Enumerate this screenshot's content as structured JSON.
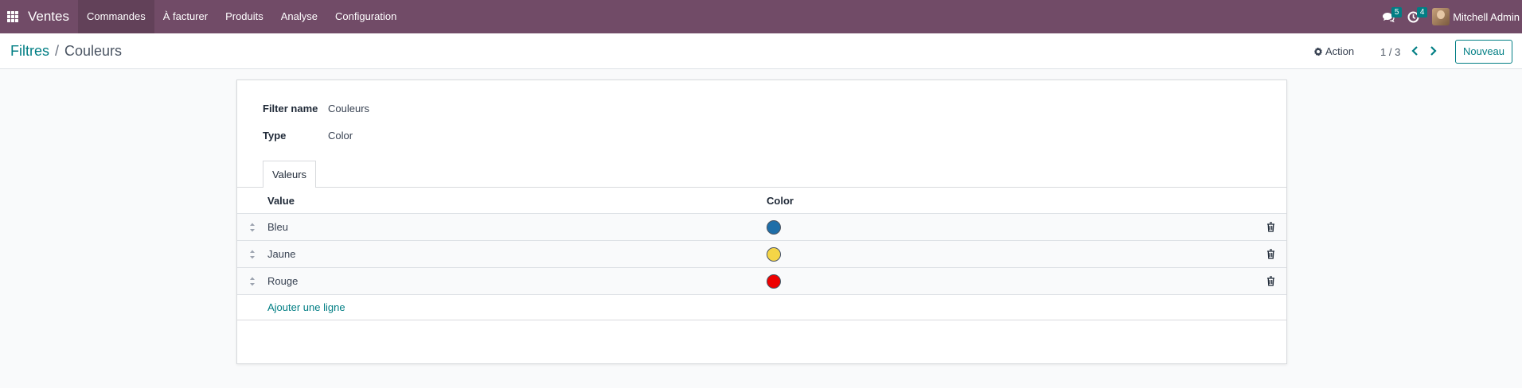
{
  "navbar": {
    "brand": "Ventes",
    "menu": [
      {
        "label": "Commandes",
        "active": true
      },
      {
        "label": "À facturer",
        "active": false
      },
      {
        "label": "Produits",
        "active": false
      },
      {
        "label": "Analyse",
        "active": false
      },
      {
        "label": "Configuration",
        "active": false
      }
    ],
    "messages_badge": "5",
    "activities_badge": "4",
    "user_name": "Mitchell Admin",
    "accent_color": "#714b67"
  },
  "control_panel": {
    "breadcrumb_parent": "Filtres",
    "breadcrumb_separator": "/",
    "breadcrumb_current": "Couleurs",
    "action_label": "Action",
    "pager": "1 / 3",
    "new_button": "Nouveau"
  },
  "form": {
    "fields": [
      {
        "label": "Filter name",
        "value": "Couleurs"
      },
      {
        "label": "Type",
        "value": "Color"
      }
    ],
    "tab_label": "Valeurs",
    "table": {
      "headers": {
        "value": "Value",
        "color": "Color"
      },
      "rows": [
        {
          "value": "Bleu",
          "color": "#1f6ea8"
        },
        {
          "value": "Jaune",
          "color": "#f5d547"
        },
        {
          "value": "Rouge",
          "color": "#ee0000"
        }
      ],
      "add_line": "Ajouter une ligne"
    }
  },
  "icons": {
    "apps": "apps-grid-icon",
    "messages": "chat-icon",
    "activities": "clock-icon",
    "action": "gear-icon",
    "pager_prev": "chevron-left-icon",
    "pager_next": "chevron-right-icon",
    "row_handle": "drag-handle-icon",
    "row_delete": "trash-icon"
  }
}
